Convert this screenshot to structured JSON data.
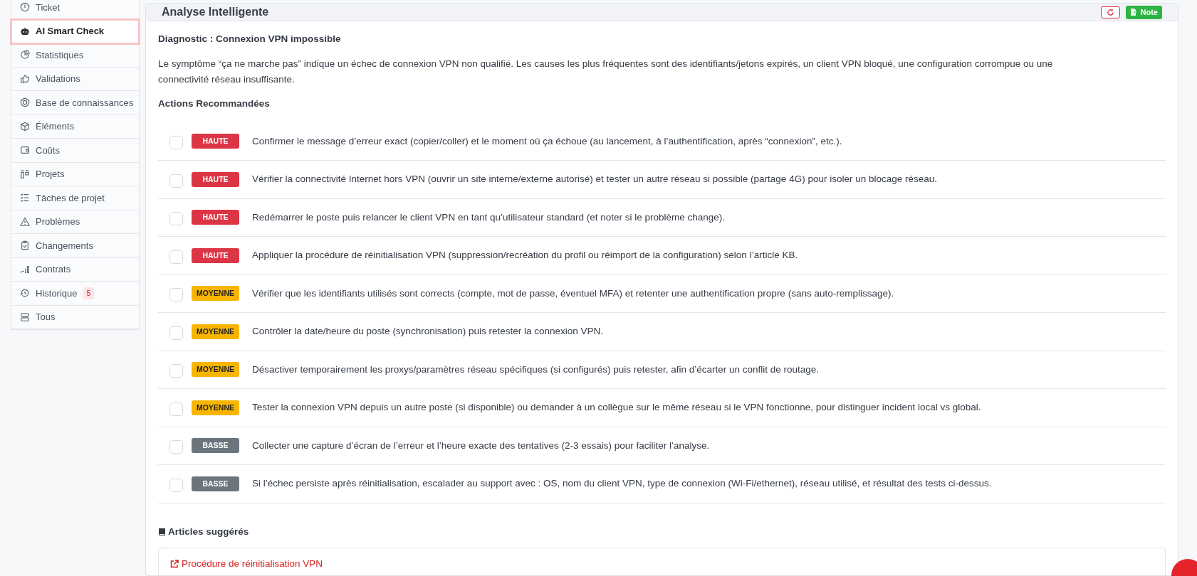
{
  "sidebar": {
    "items": [
      {
        "label": "Ticket",
        "selected": false
      },
      {
        "label": "AI Smart Check",
        "selected": true
      },
      {
        "label": "Statistiques",
        "selected": false
      },
      {
        "label": "Validations",
        "selected": false
      },
      {
        "label": "Base de connaissances",
        "selected": false
      },
      {
        "label": "Éléments",
        "selected": false
      },
      {
        "label": "Coûts",
        "selected": false
      },
      {
        "label": "Projets",
        "selected": false
      },
      {
        "label": "Tâches de projet",
        "selected": false
      },
      {
        "label": "Problèmes",
        "selected": false
      },
      {
        "label": "Changements",
        "selected": false
      },
      {
        "label": "Contrats",
        "selected": false
      },
      {
        "label": "Historique",
        "selected": false,
        "count": "5"
      },
      {
        "label": "Tous",
        "selected": false
      }
    ]
  },
  "panel": {
    "title": "Analyse Intelligente",
    "note_button": "Note",
    "diagnostic": "Diagnostic : Connexion VPN impossible",
    "summary": "Le symptôme “ça ne marche pas” indique un échec de connexion VPN non qualifié. Les causes les plus fréquentes sont des identifiants/jetons expirés, un client VPN bloqué, une configuration corrompue ou une connectivité réseau insuffisante.",
    "actions_heading": "Actions Recommandées",
    "actions": [
      {
        "kind": "high",
        "badge": "HAUTE",
        "checked": false,
        "text": "Confirmer le message d’erreur exact (copier/coller) et le moment où ça échoue (au lancement, à l’authentification, après “connexion”, etc.)."
      },
      {
        "kind": "high",
        "badge": "HAUTE",
        "checked": false,
        "text": "Vérifier la connectivité Internet hors VPN (ouvrir un site interne/externe autorisé) et tester un autre réseau si possible (partage 4G) pour isoler un blocage réseau."
      },
      {
        "kind": "high",
        "badge": "HAUTE",
        "checked": false,
        "text": "Redémarrer le poste puis relancer le client VPN en tant qu’utilisateur standard (et noter si le problème change)."
      },
      {
        "kind": "high",
        "badge": "HAUTE",
        "checked": false,
        "text": "Appliquer la procédure de réinitialisation VPN (suppression/recréation du profil ou réimport de la configuration) selon l’article KB."
      },
      {
        "kind": "medium",
        "badge": "MOYENNE",
        "checked": false,
        "text": "Vérifier que les identifiants utilisés sont corrects (compte, mot de passe, éventuel MFA) et retenter une authentification propre (sans auto-remplissage)."
      },
      {
        "kind": "medium",
        "badge": "MOYENNE",
        "checked": false,
        "text": "Contrôler la date/heure du poste (synchronisation) puis retester la connexion VPN."
      },
      {
        "kind": "medium",
        "badge": "MOYENNE",
        "checked": false,
        "text": "Désactiver temporairement les proxys/paramètres réseau spécifiques (si configurés) puis retester, afin d’écarter un conflit de routage."
      },
      {
        "kind": "medium",
        "badge": "MOYENNE",
        "checked": false,
        "text": "Tester la connexion VPN depuis un autre poste (si disponible) ou demander à un collègue sur le même réseau si le VPN fonctionne, pour distinguer incident local vs global."
      },
      {
        "kind": "low",
        "badge": "BASSE",
        "checked": false,
        "text": "Collecter une capture d’écran de l’erreur et l’heure exacte des tentatives (2-3 essais) pour faciliter l’analyse."
      },
      {
        "kind": "low",
        "badge": "BASSE",
        "checked": false,
        "text": "Si l’échec persiste après réinitialisation, escalader au support avec : OS, nom du client VPN, type de connexion (Wi-Fi/ethernet), réseau utilisé, et résultat des tests ci-dessus."
      }
    ],
    "articles_heading": "Articles suggérés",
    "articles": [
      "Procédure de réinitialisation VPN"
    ]
  }
}
